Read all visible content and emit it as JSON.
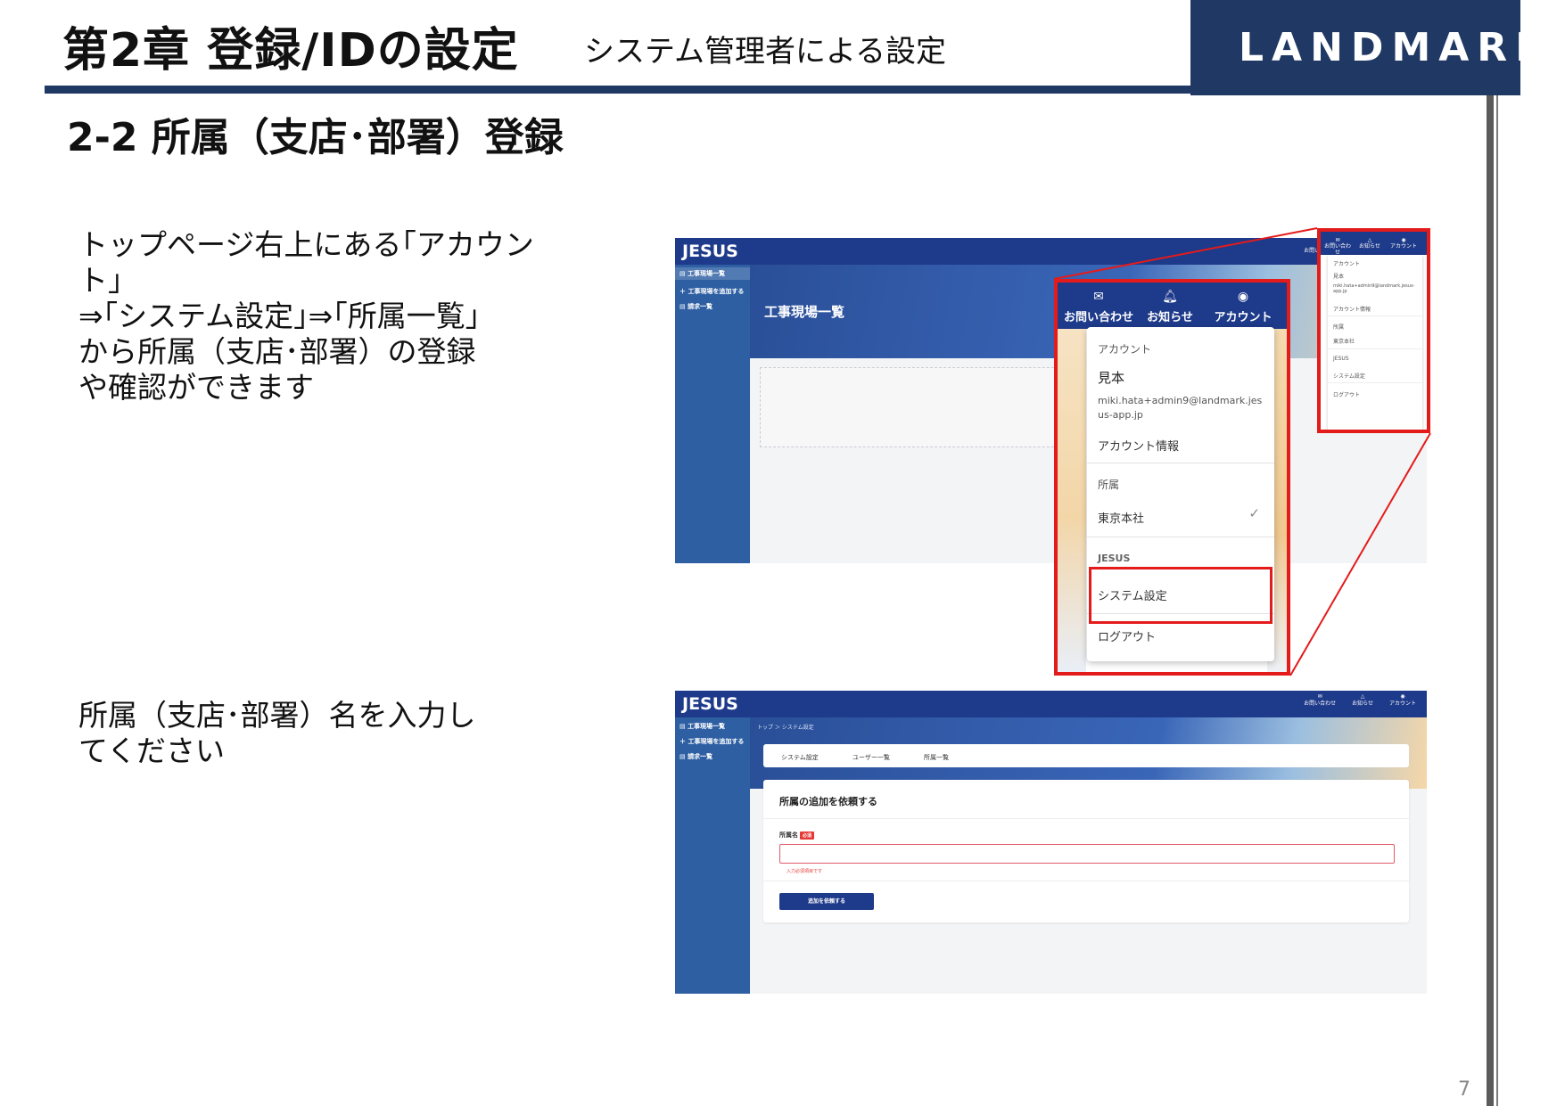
{
  "header": {
    "chapter": "第2章 登録/IDの設定",
    "subtitle": "システム管理者による設定",
    "logo_text": "LANDMARK"
  },
  "section_title": "2-2 所属（支店･部署）登録",
  "descriptions": {
    "first": "トップページ右上にある｢アカウント｣\n⇒｢システム設定｣⇒｢所属一覧｣\nから所属（支店･部署）の登録\nや確認ができます",
    "second": "所属（支店･部署）名を入力し\nてください"
  },
  "page_number": "7",
  "app": {
    "brand": "JESUS",
    "sidebar": [
      "工事現場一覧",
      "工事現場を追加する",
      "請求一覧"
    ],
    "page_title": "工事現場一覧",
    "nav": [
      "お問い合わせ",
      "お知らせ",
      "アカウント"
    ]
  },
  "account_menu": {
    "account_heading": "アカウント",
    "user_name": "見本",
    "email": "miki.hata+admin9@landmark.jesus-app.jp",
    "account_info": "アカウント情報",
    "affiliation_heading": "所属",
    "affiliation_value": "東京本社",
    "jesus_heading": "JESUS",
    "system_settings": "システム設定",
    "logout": "ログアウト"
  },
  "small_menu": {
    "email_short": "miki.hata+admin9@landmark.jesus-app.jp"
  },
  "settings_screen": {
    "breadcrumb": "トップ ＞ システム設定",
    "tabs": [
      "システム設定",
      "ユーザー一覧",
      "所属一覧"
    ],
    "form_title": "所属の追加を依頼する",
    "field_label": "所属名",
    "required_badge": "必須",
    "error_text": "入力必須項目です",
    "submit_label": "追加を依頼する"
  },
  "colors": {
    "navy": "#1f3864",
    "app_blue": "#1e3a8a",
    "highlight_red": "#e41b1b"
  }
}
